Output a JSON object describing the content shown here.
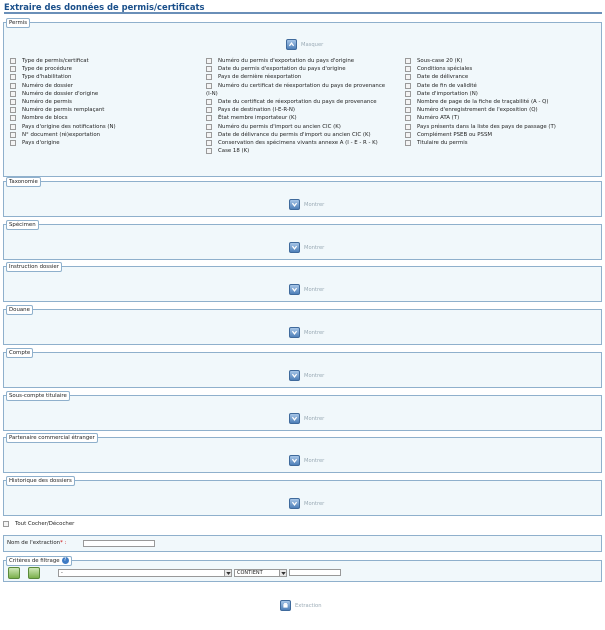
{
  "page": {
    "title": "Extraire des données de permis/certificats"
  },
  "permis": {
    "legend": "Permis",
    "toggle_label": "Masquer",
    "col1": [
      "Type de permis/certificat",
      "Type de procédure",
      "Type d'habilitation",
      "Numéro de dossier",
      "Numéro de dossier d'origine",
      "Numéro de permis",
      "Numéro de permis remplaçant",
      "Nombre de blocs",
      "Pays d'origine des notifications (N)",
      "N° document (ré)exportation",
      "Pays d'origine"
    ],
    "col2": [
      "Numéro du permis d'exportation du pays d'origine",
      "Date du permis d'exportation du pays d'origine",
      "Pays de dernière réexportation",
      "Numéro du certificat de réexportation du pays de provenance",
      "Date du certificat de réexportation du pays de provenance",
      "Pays de destination (I-E-R-N)",
      "État membre importateur (K)",
      "Numéro du permis d'import ou ancien CIC (K)",
      "Date de délivrance du permis d'import ou ancien CIC (K)",
      "Conservation des spécimens vivants annexe A (I - E - R - K)",
      "Case 18 (K)"
    ],
    "col2_wrap": "(I-N)",
    "col3": [
      "Sous-case 20 (K)",
      "Conditions spéciales",
      "Date de délivrance",
      "Date de fin de validité",
      "Date d'importation (N)",
      "Nombre de page de la fiche de traçabilité (A - Q)",
      "Numéro d'enregistrement de l'exposition (Q)",
      "Numéro ATA (T)",
      "Pays présents dans la liste des pays de passage (T)",
      "Complément PSEB ou PSSM",
      "Titulaire du permis"
    ]
  },
  "sections": [
    {
      "legend": "Taxonomie",
      "toggle_label": "Montrer"
    },
    {
      "legend": "Spécimen",
      "toggle_label": "Montrer"
    },
    {
      "legend": "Instruction dossier",
      "toggle_label": "Montrer"
    },
    {
      "legend": "Douane",
      "toggle_label": "Montrer"
    },
    {
      "legend": "Compte",
      "toggle_label": "Montrer"
    },
    {
      "legend": "Sous-compte titulaire",
      "toggle_label": "Montrer"
    },
    {
      "legend": "Partenaire commercial étranger",
      "toggle_label": "Montrer"
    },
    {
      "legend": "Historique des dossiers",
      "toggle_label": "Montrer"
    }
  ],
  "tout_cocher": "Tout Cocher/Décocher",
  "extraction_name": {
    "label": "Nom de l'extraction",
    "required_mark": "*",
    "colon": ":",
    "value": ""
  },
  "criteres": {
    "legend": "Critères de filtrage",
    "info_glyph": "?",
    "field_select": "-",
    "operator_select": "CONTIENT",
    "value": ""
  },
  "extraction_button": "Extraction",
  "colors": {
    "title": "#1a4f8a",
    "section_bg": "#f1f8fb",
    "border": "#8fb0cc",
    "accent": "#4e7fb8"
  }
}
